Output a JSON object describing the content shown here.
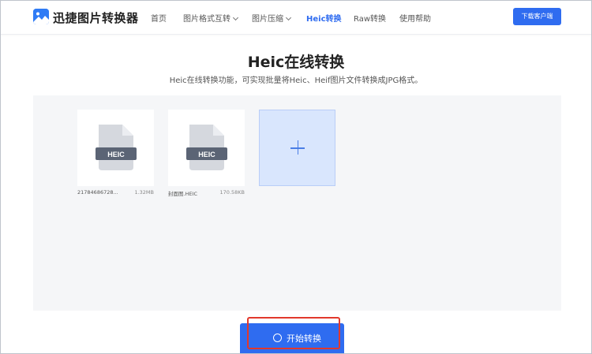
{
  "header": {
    "brand": "迅捷图片转换器",
    "nav": {
      "home": "首页",
      "format": "图片格式互转",
      "compress": "图片压缩",
      "heic": "Heic转换",
      "raw": "Raw转换",
      "help": "使用帮助"
    },
    "download_label": "下载客户端"
  },
  "main": {
    "title": "Heic在线转换",
    "subtitle": "Heic在线转换功能，可实现批量将Heic、Heif图片文件转换成JPG格式。"
  },
  "files": [
    {
      "name": "21784686728...",
      "size": "1.32MB",
      "badge": "HEIC"
    },
    {
      "name": "封面图.HEIC",
      "size": "170.58KB",
      "badge": "HEIC"
    }
  ],
  "actions": {
    "start_label": "开始转换"
  },
  "colors": {
    "accent": "#2f6cf0",
    "highlight": "#e2382c",
    "tile": "#d9e6fd"
  }
}
